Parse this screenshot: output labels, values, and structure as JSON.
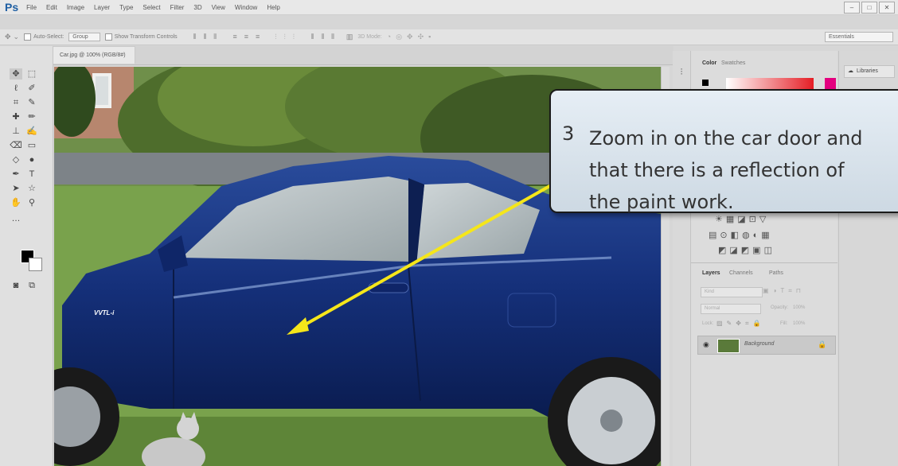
{
  "app": {
    "logo": "Ps"
  },
  "menu": [
    "File",
    "Edit",
    "Image",
    "Layer",
    "Type",
    "Select",
    "Filter",
    "3D",
    "View",
    "Window",
    "Help"
  ],
  "window_controls": {
    "minimize": "–",
    "maximize": "□",
    "close": "✕"
  },
  "options": {
    "auto_select_label": "Auto-Select:",
    "auto_select_value": "Group",
    "transform_label": "Show Transform Controls",
    "mode_3d": "3D Mode:",
    "workspace": "Essentials"
  },
  "document": {
    "tab_title": "Car.jpg @ 100% (RGB/8#)",
    "tab_close": "×"
  },
  "panels": {
    "color_tab": "Color",
    "swatches_tab": "Swatches",
    "libraries_label": "Libraries",
    "layers_tab": "Layers",
    "channels_tab": "Channels",
    "paths_tab": "Paths",
    "kind_filter": "Kind",
    "blend_mode": "Normal",
    "opacity_label": "Opacity:",
    "opacity_value": "100%",
    "lock_label": "Lock:",
    "fill_label": "Fill:",
    "fill_value": "100%",
    "layer_name": "Background"
  },
  "callout": {
    "number": "3",
    "text": "Zoom in on the car door and\nthat there is a reflection of\nthe paint work."
  },
  "car_badge": "VVTL-i",
  "colors": {
    "accent": "#1f5fa3",
    "arrow": "#f5e61a",
    "car": "#15307a",
    "swatch_fg": "#e4007f",
    "swatch_red": "#e51e25"
  }
}
